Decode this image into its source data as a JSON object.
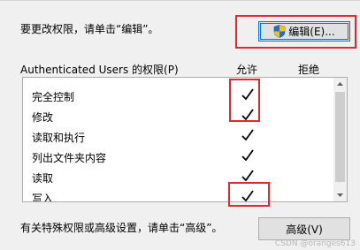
{
  "instruction": "要更改权限，请单击“编辑”。",
  "edit_button": {
    "label": "编辑(E)..."
  },
  "permissions_header": "Authenticated Users 的权限(P)",
  "columns": {
    "allow": "允许",
    "deny": "拒绝"
  },
  "permissions": [
    {
      "name": "完全控制",
      "allow": true,
      "deny": false
    },
    {
      "name": "修改",
      "allow": true,
      "deny": false
    },
    {
      "name": "读取和执行",
      "allow": true,
      "deny": false
    },
    {
      "name": "列出文件夹内容",
      "allow": true,
      "deny": false
    },
    {
      "name": "读取",
      "allow": true,
      "deny": false
    },
    {
      "name": "写入",
      "allow": true,
      "deny": false
    }
  ],
  "special_text": "有关特殊权限或高级设置，请单击“高级”。",
  "advanced_button": {
    "label": "高级(V)"
  },
  "watermark": "CSDN @oranges613",
  "colors": {
    "highlight": "#e0282e",
    "button_focus_border": "#0078d7"
  },
  "icons": {
    "edit_button": "uac-shield-icon",
    "check": "checkmark-icon"
  }
}
